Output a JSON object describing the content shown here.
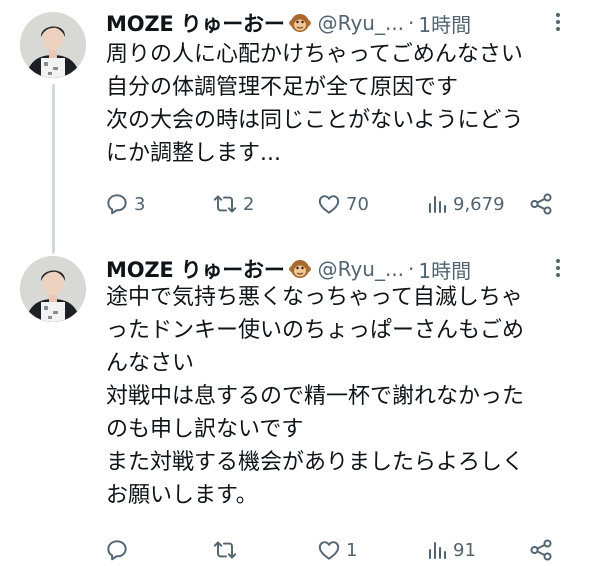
{
  "tweets": [
    {
      "author": {
        "name": "MOZE りゅーおー",
        "handle": "@Ryu_...",
        "badge_icon": "monkey-emoji-icon"
      },
      "separator": "·",
      "time": "1時間",
      "text_lines": [
        "周りの人に心配かけちゃってごめんなさい",
        "自分の体調管理不足が全て原因です",
        "次の大会の時は同じことがないようにどう",
        "にか調整します..."
      ],
      "actions": {
        "replies": "3",
        "retweets": "2",
        "likes": "70",
        "views": "9,679"
      }
    },
    {
      "author": {
        "name": "MOZE りゅーおー",
        "handle": "@Ryu_...",
        "badge_icon": "monkey-emoji-icon"
      },
      "separator": "·",
      "time": "1時間",
      "text_lines": [
        "途中で気持ち悪くなっちゃって自滅しちゃ",
        "ったドンキー使いのちょっぱーさんもごめ",
        "んなさい",
        "対戦中は息するので精一杯で謝れなかった",
        "のも申し訳ないです",
        "また対戦する機会がありましたらよろしく",
        "お願いします。"
      ],
      "actions": {
        "replies": "",
        "retweets": "",
        "likes": "1",
        "views": "91"
      }
    }
  ],
  "colors": {
    "text": "#0f1419",
    "secondary": "#536471",
    "thread_line": "#cfd9de"
  }
}
